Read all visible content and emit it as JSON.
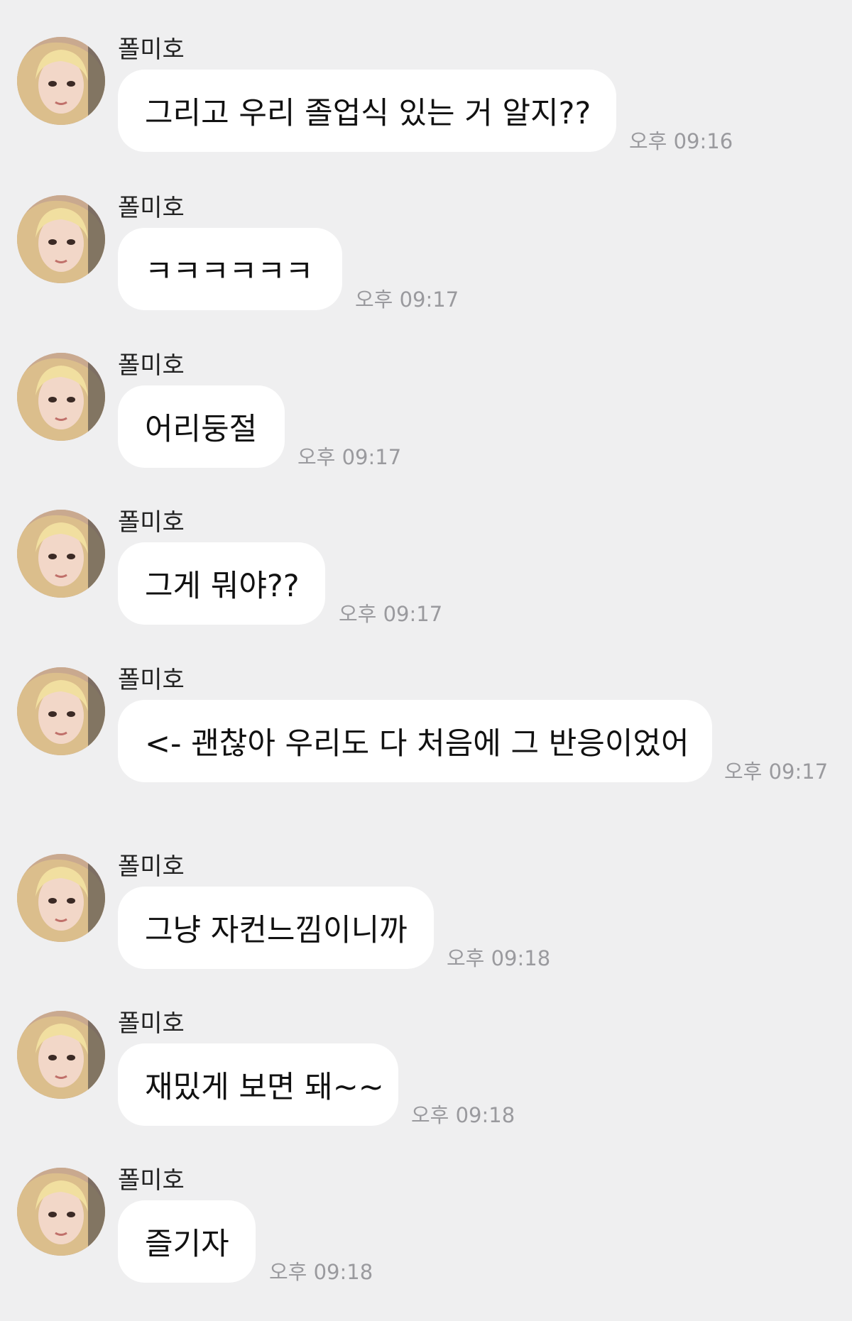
{
  "chat": {
    "messages": [
      {
        "sender": "폴미호",
        "text": "그리고 우리 졸업식 있는 거 알지??",
        "time": "오후 09:16"
      },
      {
        "sender": "폴미호",
        "text": "ㅋㅋㅋㅋㅋㅋ",
        "time": "오후 09:17"
      },
      {
        "sender": "폴미호",
        "text": "어리둥절",
        "time": "오후 09:17"
      },
      {
        "sender": "폴미호",
        "text": "그게 뭐야??",
        "time": "오후 09:17"
      },
      {
        "sender": "폴미호",
        "text": "<- 괜찮아 우리도 다 처음에 그 반응이었어",
        "time": "오후 09:17"
      },
      {
        "sender": "폴미호",
        "text": "그냥 자컨느낌이니까",
        "time": "오후 09:18"
      },
      {
        "sender": "폴미호",
        "text": "재밌게 보면 돼~~",
        "time": "오후 09:18"
      },
      {
        "sender": "폴미호",
        "text": "즐기자",
        "time": "오후 09:18"
      }
    ]
  }
}
